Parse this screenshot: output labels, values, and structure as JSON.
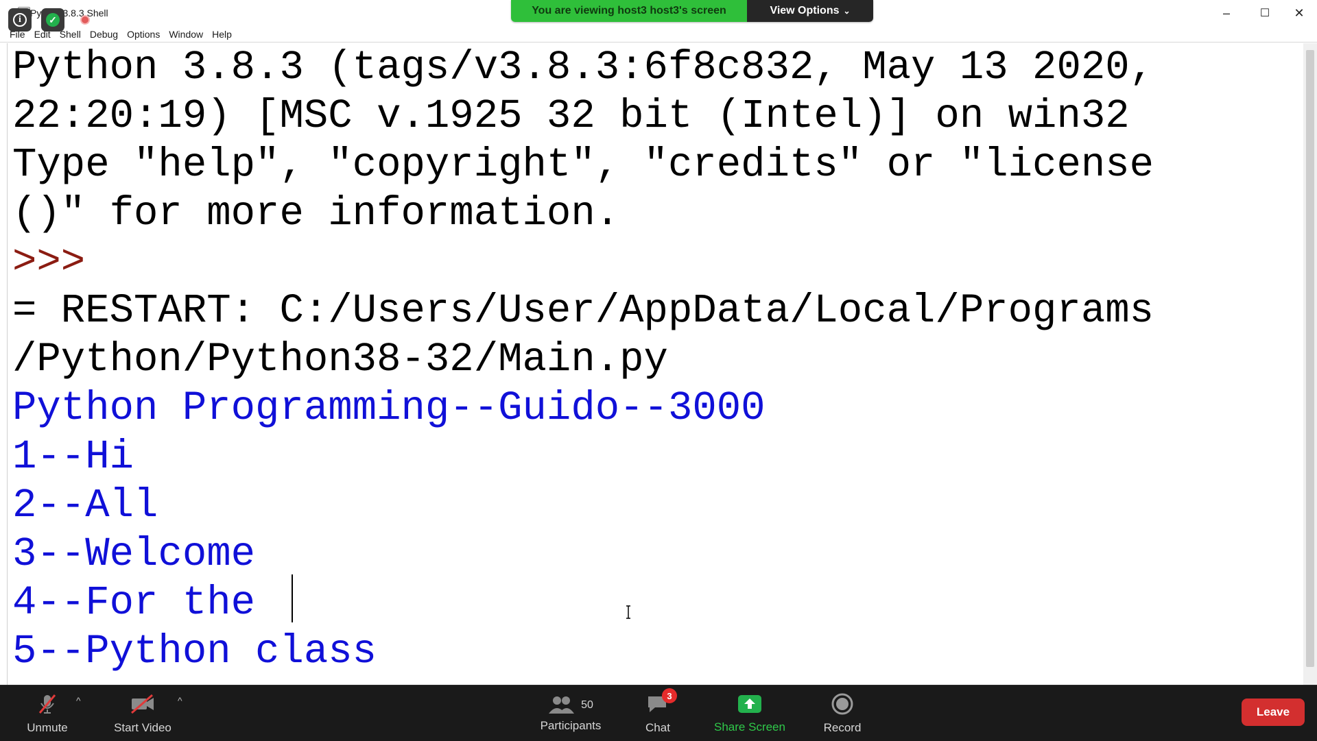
{
  "window": {
    "title": "Python 3.8.3 Shell",
    "controls": {
      "minimize": "–",
      "maximize": "☐",
      "close": "✕"
    }
  },
  "menu": [
    "File",
    "Edit",
    "Shell",
    "Debug",
    "Options",
    "Window",
    "Help"
  ],
  "banner": {
    "viewing_text": "You are viewing host3 host3's screen",
    "view_options": "View Options"
  },
  "shell": {
    "lines": [
      {
        "text": "Python 3.8.3 (tags/v3.8.3:6f8c832, May 13 2020,",
        "style": "normal"
      },
      {
        "text": "22:20:19) [MSC v.1925 32 bit (Intel)] on win32",
        "style": "normal"
      },
      {
        "text": "Type \"help\", \"copyright\", \"credits\" or \"license",
        "style": "normal"
      },
      {
        "text": "()\" for more information.",
        "style": "normal"
      },
      {
        "text": ">>>",
        "style": "prompt"
      },
      {
        "text": "= RESTART: C:/Users/User/AppData/Local/Programs",
        "style": "normal"
      },
      {
        "text": "/Python/Python38-32/Main.py",
        "style": "normal"
      },
      {
        "text": "Python Programming--Guido--3000",
        "style": "output"
      },
      {
        "text": "1--Hi",
        "style": "output"
      },
      {
        "text": "2--All",
        "style": "output"
      },
      {
        "text": "3--Welcome",
        "style": "output"
      },
      {
        "text": "4--For the",
        "style": "output"
      },
      {
        "text": "5--Python class",
        "style": "output"
      }
    ]
  },
  "toolbar": {
    "unmute": "Unmute",
    "start_video": "Start Video",
    "participants": "Participants",
    "participants_count": "50",
    "chat": "Chat",
    "chat_badge": "3",
    "share_screen": "Share Screen",
    "record": "Record",
    "leave": "Leave"
  },
  "icons": {
    "info": "info-icon",
    "security": "shield-check-icon",
    "recording": "recording-dot-icon"
  },
  "colors": {
    "prompt": "#8b1c12",
    "output": "#1010d8",
    "banner_green": "#2fbf3a",
    "leave_red": "#d32f2f"
  }
}
